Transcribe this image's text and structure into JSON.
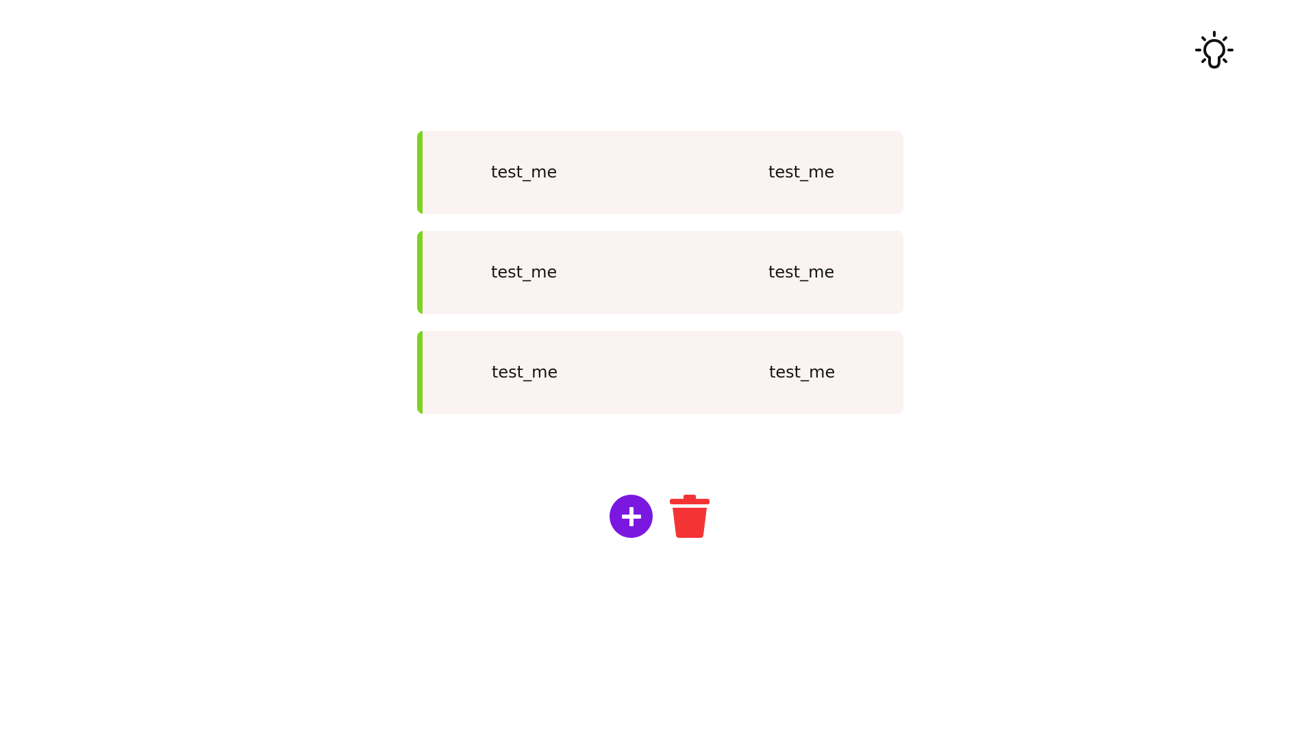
{
  "header": {
    "theme_toggle_icon": "lightbulb-icon"
  },
  "items": [
    {
      "left": "test_me",
      "right": "test_me"
    },
    {
      "left": "test_me",
      "right": "test_me"
    },
    {
      "left": "test_me",
      "right": "test_me"
    }
  ],
  "actions": {
    "add_icon": "plus-circle-icon",
    "delete_icon": "trash-icon"
  },
  "colors": {
    "accent": "#7ed321",
    "card_background": "#faf3f1",
    "add_button": "#7a18e0",
    "delete_button": "#f43434",
    "text": "#151515",
    "icon": "#111111"
  }
}
